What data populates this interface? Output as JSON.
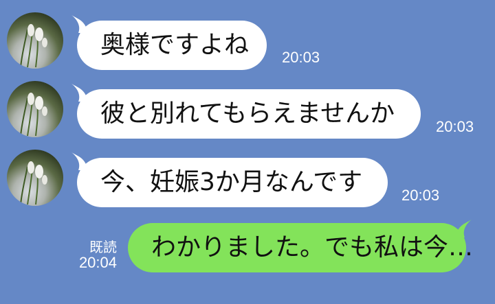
{
  "messages": [
    {
      "text": "奥様ですよね",
      "time": "20:03",
      "direction": "incoming",
      "avatar_icon": "snowdrop-flower-avatar"
    },
    {
      "text": "彼と別れてもらえませんか",
      "time": "20:03",
      "direction": "incoming",
      "avatar_icon": "snowdrop-flower-avatar"
    },
    {
      "text": "今、妊娠3か月なんです",
      "time": "20:03",
      "direction": "incoming",
      "avatar_icon": "snowdrop-flower-avatar"
    },
    {
      "text": "わかりました。でも私は今…",
      "time": "20:04",
      "direction": "outgoing",
      "read_label": "既読"
    }
  ],
  "colors": {
    "background": "#6588c6",
    "incoming_bubble": "#ffffff",
    "outgoing_bubble": "#83e35a",
    "meta_text": "#ffffff"
  }
}
